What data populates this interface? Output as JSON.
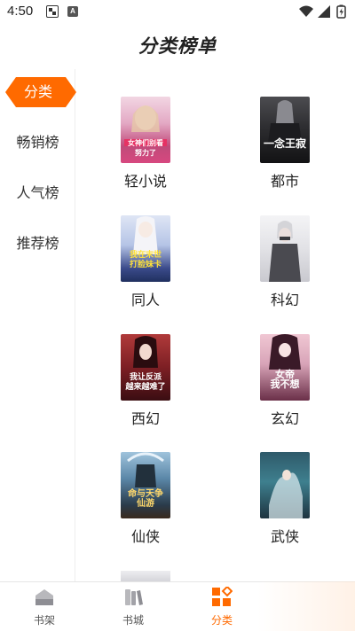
{
  "status_bar": {
    "time": "4:50",
    "icons": [
      "notification-icon",
      "a-badge-icon",
      "wifi-icon",
      "signal-icon",
      "battery-charging-icon"
    ]
  },
  "header": {
    "title": "分类榜单"
  },
  "sidebar": {
    "accent_color": "#ff6a00",
    "items": [
      {
        "label": "分类",
        "active": true
      },
      {
        "label": "畅销榜",
        "active": false
      },
      {
        "label": "人气榜",
        "active": false
      },
      {
        "label": "推荐榜",
        "active": false
      }
    ]
  },
  "categories": [
    {
      "label": "轻小说",
      "cover_text": "女神们别看\n努力了"
    },
    {
      "label": "都市",
      "cover_text": "一念王寂"
    },
    {
      "label": "同人",
      "cover_text": "我在末世\n打脸妹卡"
    },
    {
      "label": "科幻",
      "cover_text": ""
    },
    {
      "label": "西幻",
      "cover_text": "我让反派\n越来越难了"
    },
    {
      "label": "玄幻",
      "cover_text": "女帝\n我不想"
    },
    {
      "label": "仙侠",
      "cover_text": "命与天争\n仙游"
    },
    {
      "label": "武侠",
      "cover_text": ""
    }
  ],
  "bottom_nav": {
    "items": [
      {
        "label": "书架",
        "icon": "bookshelf-icon",
        "active": false
      },
      {
        "label": "书城",
        "icon": "bookstore-icon",
        "active": false
      },
      {
        "label": "分类",
        "icon": "category-grid-icon",
        "active": true
      }
    ],
    "active_color": "#ff6a00",
    "inactive_color": "#555555"
  }
}
